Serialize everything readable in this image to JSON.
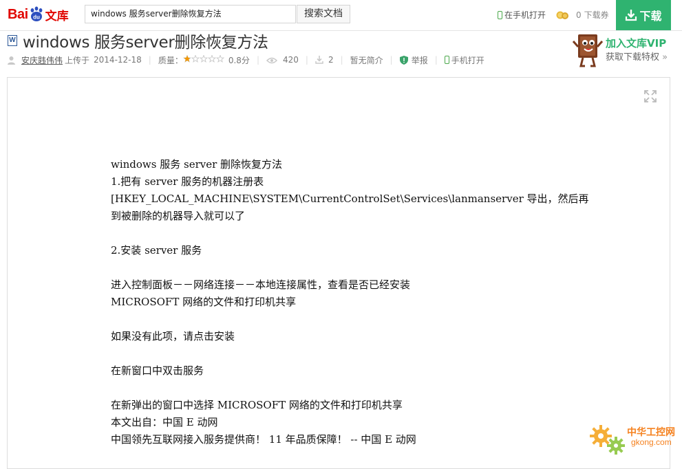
{
  "header": {
    "logo_bai": "Bai",
    "logo_du": "du",
    "logo_wenku": "文库",
    "search_value": "windows 服务server删除恢复方法",
    "search_button": "搜索文档",
    "mobile_open": "在手机打开",
    "coupon_count": "0",
    "coupon_label": "下载券",
    "download_button": "下载"
  },
  "doc_title": "windows 服务server删除恢复方法",
  "meta": {
    "author": "安庆韪伟伟",
    "uploaded_label": "上传于",
    "upload_date": "2014-12-18",
    "quality_label": "质量：",
    "rating_fraction": 0.16,
    "score": "0.8分",
    "views": "420",
    "downloads": "2",
    "no_summary": "暂无简介",
    "report": "举报",
    "mobile_open": "手机打开"
  },
  "vip": {
    "line1": "加入文库VIP",
    "line2": "获取下载特权"
  },
  "document": {
    "lines": [
      "windows  服务 server 删除恢复方法",
      "1.把有 server 服务的机器注册表",
      "[HKEY_LOCAL_MACHINE\\SYSTEM\\CurrentControlSet\\Services\\lanmanserver 导出，然后再",
      "到被删除的机器导入就可以了",
      "",
      "2.安装 server 服务",
      "",
      "进入控制面板－－网络连接－－本地连接属性，查看是否已经安装",
      "MICROSOFT 网络的文件和打印机共享",
      "",
      "如果没有此项，请点击安装",
      "",
      "在新窗口中双击服务",
      "",
      "在新弹出的窗口中选择 MICROSOFT 网络的文件和打印机共享",
      "本文出自：中国 E 动网",
      "中国领先互联网接入服务提供商！ 11 年品质保障！ --  中国 E 动网"
    ]
  },
  "watermark": {
    "line1": "中华工控网",
    "line2": "gkong.com"
  },
  "colors": {
    "brand_red": "#e10601",
    "download_green": "#2fb370",
    "star_orange": "#f39800"
  }
}
